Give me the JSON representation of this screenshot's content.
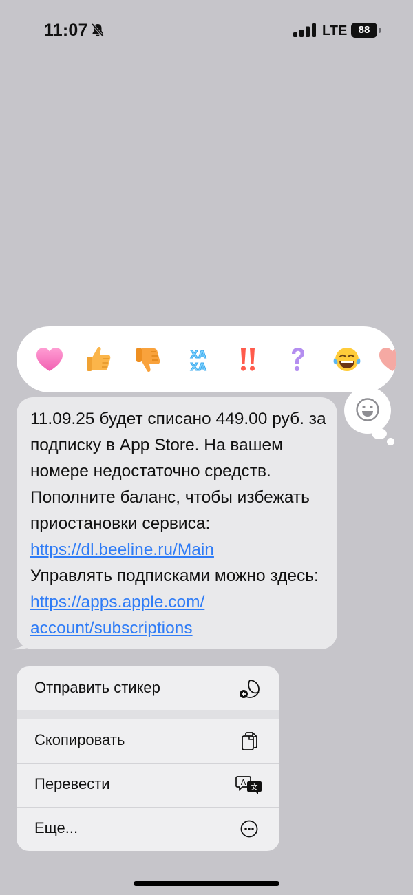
{
  "status_bar": {
    "time": "11:07",
    "network": "LTE",
    "battery": "88",
    "icons": [
      "bell-slash-icon",
      "signal-icon",
      "battery-icon"
    ]
  },
  "reactions": [
    {
      "name": "heart",
      "icon": "heart-icon"
    },
    {
      "name": "thumbs-up",
      "icon": "thumbs-up-icon"
    },
    {
      "name": "thumbs-down",
      "icon": "thumbs-down-icon"
    },
    {
      "name": "haha",
      "icon": "haha-icon"
    },
    {
      "name": "exclamation",
      "icon": "double-exclamation-icon"
    },
    {
      "name": "question",
      "icon": "question-icon"
    },
    {
      "name": "laughing",
      "icon": "tears-of-joy-icon"
    },
    {
      "name": "more",
      "icon": "partial-heart-icon"
    }
  ],
  "message": {
    "text_1": "11.09.25 будет списано 449.00 руб. за подписку в App Store. На вашем номере недостаточно средств. Пополните баланс, чтобы избежать приостановки сервиса: ",
    "link_1": "https://dl.beeline.ru/Main",
    "text_2": "Управлять подписками можно здесь: ",
    "link_2": "https://apps.apple.com/ account/subscriptions"
  },
  "menu": {
    "send_sticker": "Отправить стикер",
    "copy": "Скопировать",
    "translate": "Перевести",
    "more": "Еще..."
  },
  "colors": {
    "background": "#c6c5ca",
    "bubble": "#e9e9eb",
    "link": "#2f7cf6",
    "menu": "#efeff1"
  }
}
